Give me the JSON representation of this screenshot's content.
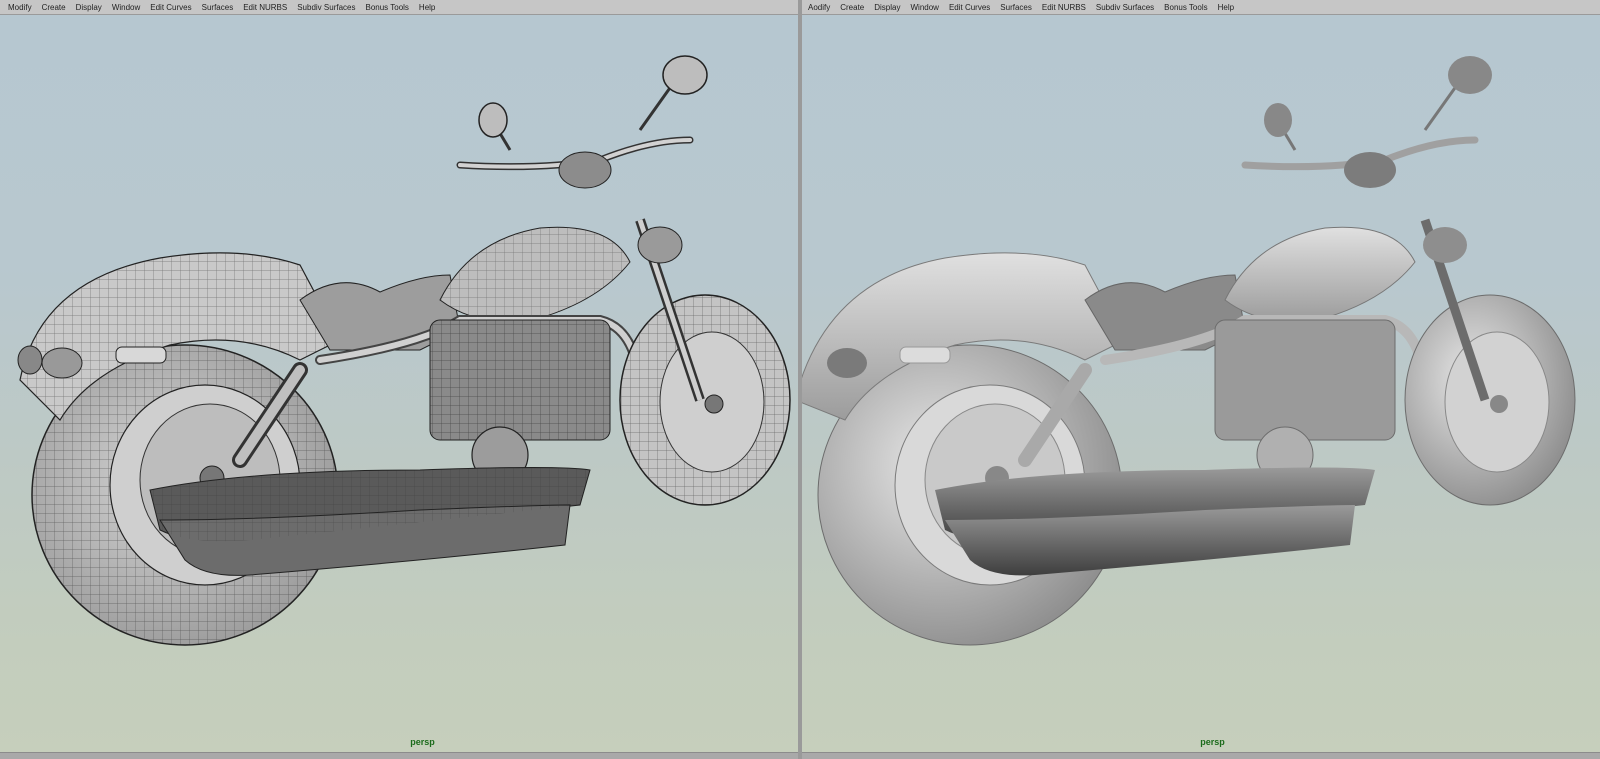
{
  "viewports": [
    {
      "menu": [
        "Modify",
        "Create",
        "Display",
        "Window",
        "Edit Curves",
        "Surfaces",
        "Edit NURBS",
        "Subdiv Surfaces",
        "Bonus Tools",
        "Help"
      ],
      "camera": "persp"
    },
    {
      "menu": [
        "Aodify",
        "Create",
        "Display",
        "Window",
        "Edit Curves",
        "Surfaces",
        "Edit NURBS",
        "Subdiv Surfaces",
        "Bonus Tools",
        "Help"
      ],
      "camera": "persp"
    }
  ],
  "colors": {
    "menubar": "#c6c6c6",
    "camera_label": "#1c6b1c",
    "sky_top": "#b6c7d0",
    "ground": "#c6cfbc"
  }
}
